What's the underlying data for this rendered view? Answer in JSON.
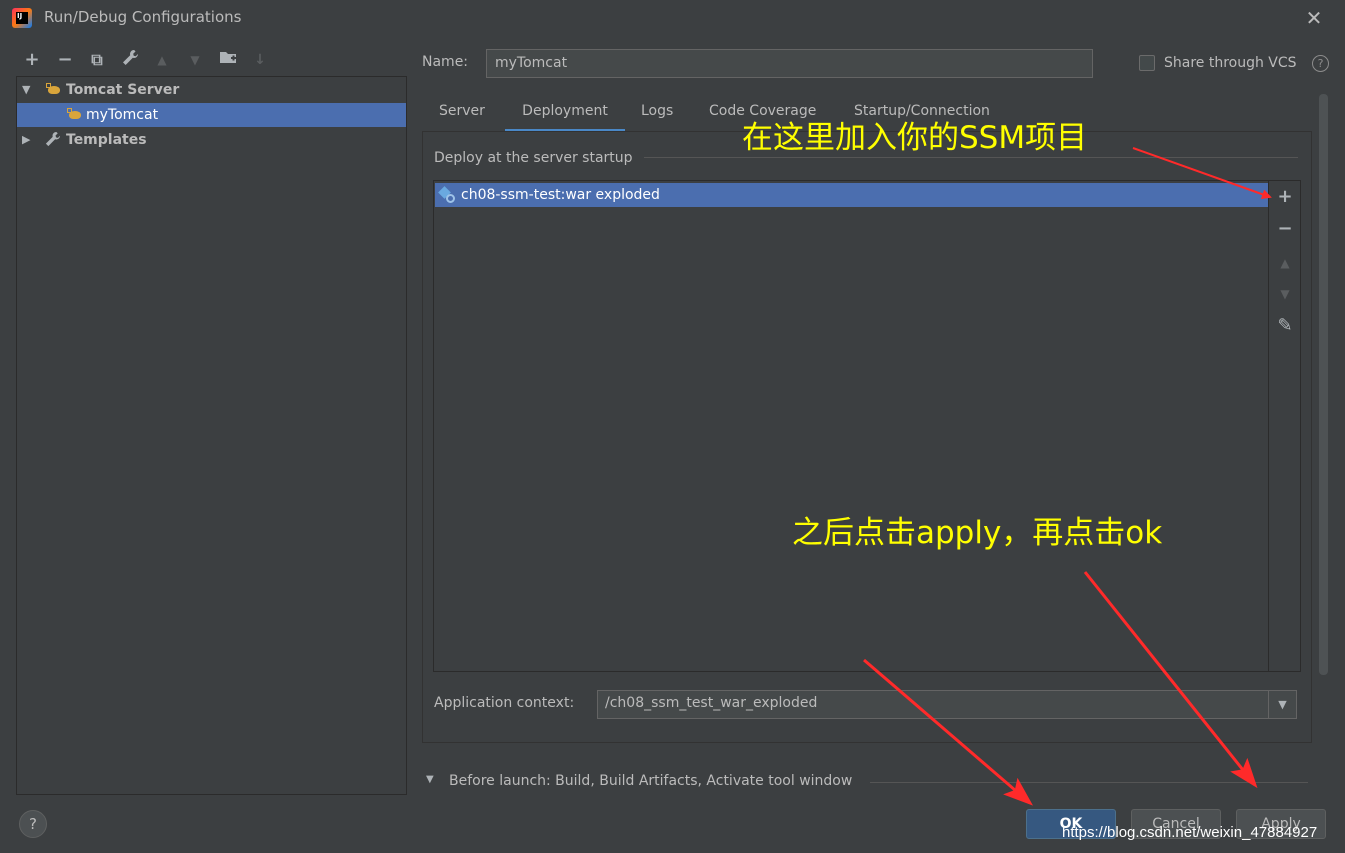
{
  "window": {
    "title": "Run/Debug Configurations",
    "close_glyph": "✕",
    "app_icon_text": "IJ"
  },
  "left_toolbar": {
    "icons": [
      "add-icon",
      "remove-icon",
      "copy-icon",
      "wrench-icon",
      "move-up-icon",
      "move-down-icon",
      "new-folder-icon",
      "sort-icon"
    ],
    "glyphs": {
      "add": "+",
      "remove": "−",
      "copy": "⧉",
      "wrench": "🔧",
      "up": "▲",
      "down": "▼",
      "folder": "▆",
      "sort": "↓"
    }
  },
  "tree": {
    "group": {
      "label": "Tomcat Server",
      "arrow": "▼"
    },
    "child": {
      "label": "myTomcat"
    },
    "templates": {
      "label": "Templates",
      "arrow": "▶"
    }
  },
  "form": {
    "name_label": "Name:",
    "name_value": "myTomcat",
    "share_vcs_label": "Share through VCS",
    "share_vcs_checked": false,
    "help_glyph": "?"
  },
  "tabs": [
    {
      "label": "Server",
      "active": false
    },
    {
      "label": "Deployment",
      "active": true
    },
    {
      "label": "Logs",
      "active": false
    },
    {
      "label": "Code Coverage",
      "active": false
    },
    {
      "label": "Startup/Connection",
      "active": false
    }
  ],
  "deployment": {
    "section_title": "Deploy at the server startup",
    "items": [
      {
        "label": "ch08-ssm-test:war exploded",
        "icon": "artifact-icon"
      }
    ],
    "list_toolbar": {
      "add": "+",
      "remove": "−",
      "up": "▲",
      "down": "▼",
      "edit": "✎"
    },
    "context_label": "Application context:",
    "context_value": "/ch08_ssm_test_war_exploded",
    "context_arrow": "▼"
  },
  "before_launch": {
    "arrow": "▼",
    "label": "Before launch: Build, Build Artifacts, Activate tool window"
  },
  "buttons": {
    "help": "?",
    "ok": "OK",
    "cancel": "Cancel",
    "apply": "Apply"
  },
  "annotations": {
    "note_add": "在这里加入你的SSM项目",
    "note_apply": "之后点击apply，再点击ok",
    "watermark": "https://blog.csdn.net/weixin_47884927",
    "arrow_color": "#ff2a2a",
    "text_color": "#ffff00"
  },
  "colors": {
    "background": "#3c3f41",
    "selection": "#4b6eaf",
    "ok_button": "#365880",
    "tab_underline": "#4a88c7"
  }
}
